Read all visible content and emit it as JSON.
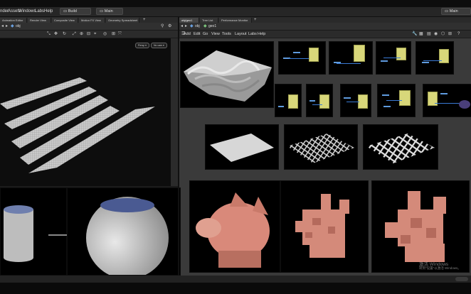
{
  "menu": [
    "nder",
    "Assets",
    "Windows",
    "Labs",
    "Help"
  ],
  "desktop_tabs": [
    {
      "label": "Build",
      "icon": "desktop-icon"
    },
    {
      "label": "Main",
      "icon": "desktop-icon"
    }
  ],
  "desktop_right_label": "Main",
  "left_tabs": [
    "Animation Editor",
    "Render View",
    "Composite View",
    "Motion FX View",
    "Geometry Spreadsheet"
  ],
  "right_tabs": [
    "obj/geo1",
    "Tree List",
    "Performance Monitor"
  ],
  "left_path": "obj",
  "right_path_obj": "obj",
  "right_path_geo": "geo1",
  "network_menu": [
    "Add",
    "Edit",
    "Go",
    "View",
    "Tools",
    "Layout",
    "Labs",
    "Help"
  ],
  "viewport_buttons": {
    "persp": "Persp ▾",
    "cam": "No cam ▾"
  },
  "watermark": {
    "title": "激活 Windows",
    "subtitle": "转到\"设置\"以激活 Windows。"
  },
  "colors": {
    "accent": "#3a7bd5",
    "node": "#d8d77a",
    "pig": "#d9897a",
    "viewport_bg": "#000000",
    "panel_bg": "#3c3c3c"
  }
}
